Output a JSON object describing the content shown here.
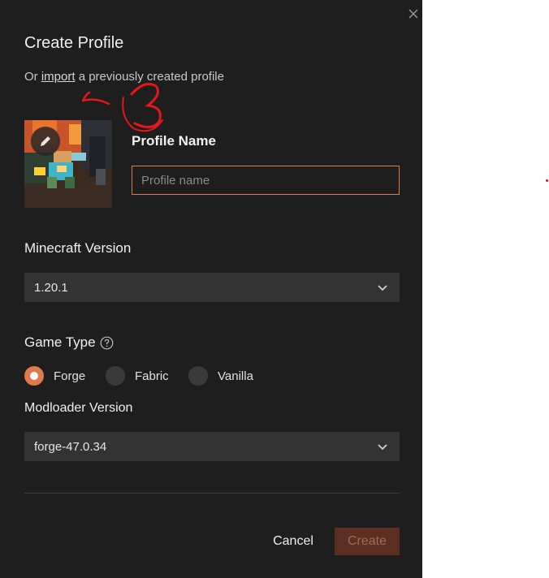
{
  "dialog": {
    "title": "Create Profile",
    "import_prefix": "Or ",
    "import_link": "import",
    "import_suffix": " a previously created profile",
    "profile_name": {
      "label": "Profile Name",
      "placeholder": "Profile name",
      "value": ""
    },
    "minecraft_version": {
      "label": "Minecraft Version",
      "selected": "1.20.1"
    },
    "game_type": {
      "label": "Game Type",
      "options": [
        "Forge",
        "Fabric",
        "Vanilla"
      ],
      "selected": "Forge"
    },
    "modloader_version": {
      "label": "Modloader Version",
      "selected": "forge-47.0.34"
    },
    "buttons": {
      "cancel": "Cancel",
      "create": "Create"
    }
  },
  "annotation": {
    "text": "3",
    "color": "#e31818"
  },
  "colors": {
    "dialog_bg": "#1e1e1e",
    "accent": "#e0794c",
    "select_bg": "#333333",
    "create_bg": "#5b2f22"
  },
  "icons": {
    "close": "close-icon",
    "edit": "pencil-icon",
    "help": "help-circle-icon",
    "chevron": "chevron-down-icon"
  }
}
